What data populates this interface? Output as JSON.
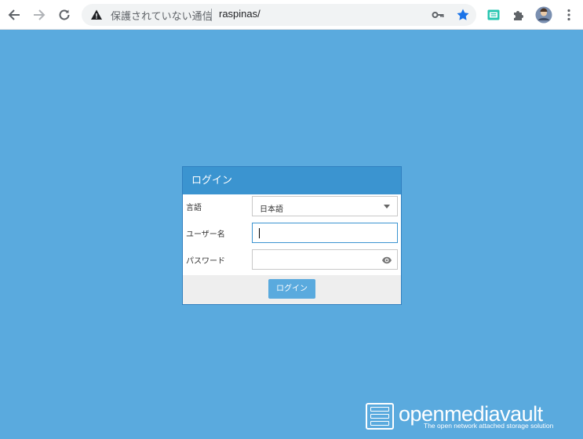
{
  "browser": {
    "security_label": "保護されていない通信",
    "url": "raspinas/"
  },
  "dialog": {
    "title": "ログイン",
    "language_label": "言語",
    "language_value": "日本語",
    "username_label": "ユーザー名",
    "username_value": "",
    "password_label": "パスワード",
    "password_value": "",
    "login_button": "ログイン"
  },
  "logo": {
    "name": "openmediavault",
    "tagline": "The open network attached storage solution"
  },
  "colors": {
    "background": "#5aaade",
    "header": "#3b94d0",
    "star": "#1a73e8"
  }
}
